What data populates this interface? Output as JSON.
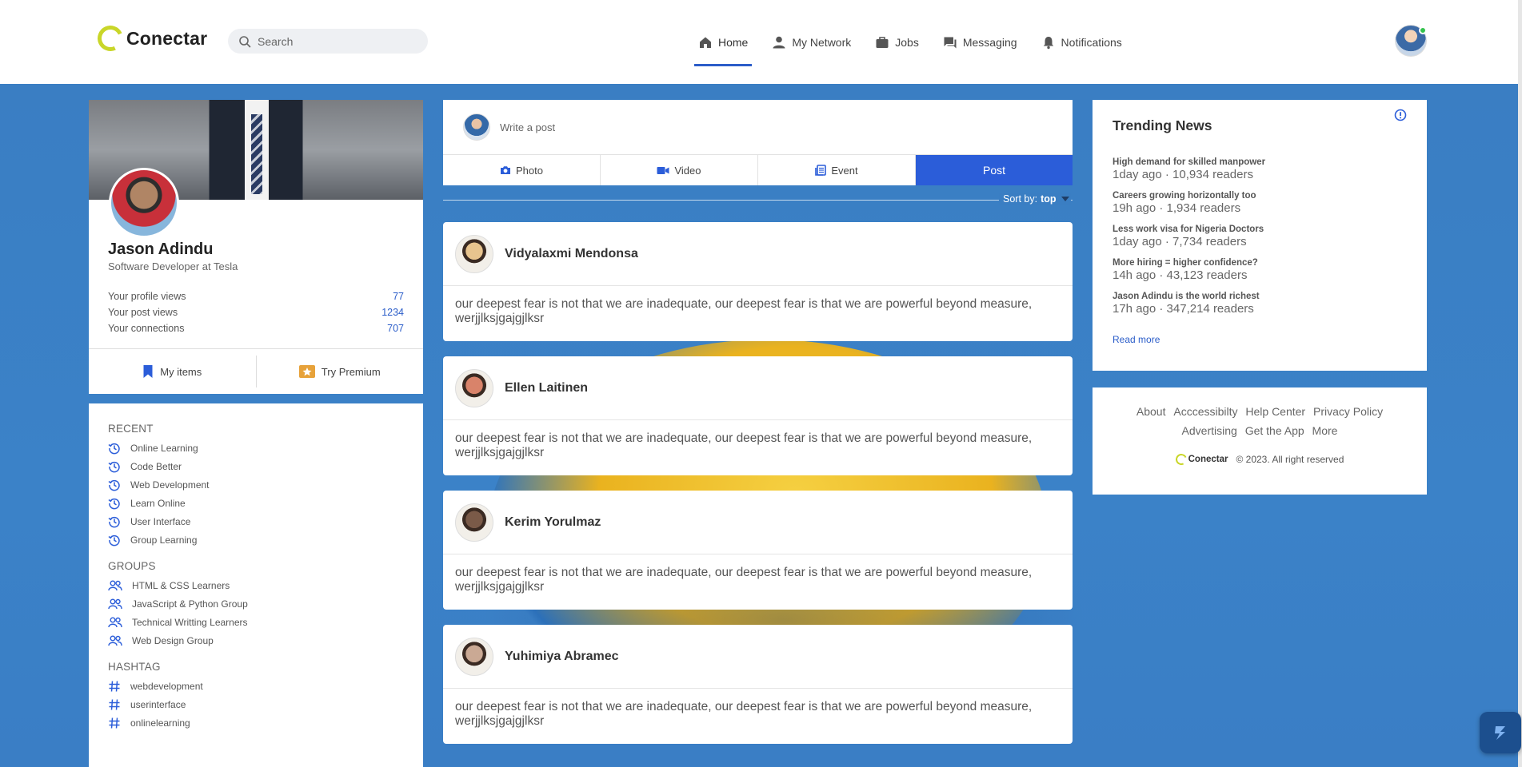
{
  "header": {
    "logo": "Conectar",
    "search_placeholder": "Search",
    "nav": [
      {
        "label": "Home",
        "icon": "home-icon",
        "active": true
      },
      {
        "label": "My Network",
        "icon": "person-icon"
      },
      {
        "label": "Jobs",
        "icon": "briefcase-icon"
      },
      {
        "label": "Messaging",
        "icon": "chat-icon"
      },
      {
        "label": "Notifications",
        "icon": "bell-icon"
      }
    ]
  },
  "profile": {
    "name": "Jason Adindu",
    "title": "Software Developer at Tesla",
    "stats": [
      {
        "label": "Your profile views",
        "value": "77"
      },
      {
        "label": "Your post views",
        "value": "1234"
      },
      {
        "label": "Your connections",
        "value": "707"
      }
    ],
    "actions": [
      {
        "label": "My items",
        "icon": "bookmark-icon"
      },
      {
        "label": "Try Premium",
        "icon": "premium-icon"
      }
    ]
  },
  "sidebar": {
    "recent_title": "RECENT",
    "recent": [
      "Online Learning",
      "Code Better",
      "Web Development",
      "Learn Online",
      "User Interface",
      "Group Learning"
    ],
    "groups_title": "GROUPS",
    "groups": [
      "HTML & CSS Learners",
      "JavaScript & Python Group",
      "Technical Writting Learners",
      "Web Design Group"
    ],
    "hashtag_title": "HASHTAG",
    "hashtags": [
      "webdevelopment",
      "userinterface",
      "onlinelearning"
    ]
  },
  "composer": {
    "placeholder": "Write a post",
    "tabs": [
      {
        "label": "Photo",
        "icon": "camera-icon"
      },
      {
        "label": "Video",
        "icon": "video-icon"
      },
      {
        "label": "Event",
        "icon": "event-icon"
      },
      {
        "label": "Post",
        "primary": true
      }
    ]
  },
  "sort": {
    "label": "Sort by:",
    "value": "top"
  },
  "posts": [
    {
      "author": "Vidyalaxmi Mendonsa",
      "text": "our deepest fear is not that we are inadequate, our deepest fear is that we are powerful beyond measure, werjjlksjgajgjlksr",
      "avatar_color": "#e8c48e"
    },
    {
      "author": "Ellen Laitinen",
      "text": "our deepest fear is not that we are inadequate, our deepest fear is that we are powerful beyond measure, werjjlksjgajgjlksr",
      "avatar_color": "#d9836a"
    },
    {
      "author": "Kerim Yorulmaz",
      "text": "our deepest fear is not that we are inadequate, our deepest fear is that we are powerful beyond measure, werjjlksjgajgjlksr",
      "avatar_color": "#7a5a48"
    },
    {
      "author": "Yuhimiya Abramec",
      "text": "our deepest fear is not that we are inadequate, our deepest fear is that we are powerful beyond measure, werjjlksjgajgjlksr",
      "avatar_color": "#caa994"
    }
  ],
  "trending": {
    "title": "Trending News",
    "items": [
      {
        "title": "High demand for skilled manpower",
        "meta": "1day ago · 10,934 readers"
      },
      {
        "title": "Careers growing horizontally too",
        "meta": "19h ago · 1,934 readers"
      },
      {
        "title": "Less work visa for Nigeria Doctors",
        "meta": "1day ago · 7,734 readers"
      },
      {
        "title": "More hiring = higher confidence?",
        "meta": "14h ago · 43,123 readers"
      },
      {
        "title": "Jason Adindu is the world richest",
        "meta": "17h ago · 347,214 readers"
      }
    ],
    "read_more": "Read more"
  },
  "footer": {
    "links": [
      "About",
      "Acccessibilty",
      "Help Center",
      "Privacy Policy",
      "Advertising",
      "Get the App",
      "More"
    ],
    "logo": "Conectar",
    "copyright": "© 2023. All right reserved"
  },
  "colors": {
    "accent": "#2b5dd9",
    "logo": "#c9d629",
    "background": "#3a7ec3"
  }
}
